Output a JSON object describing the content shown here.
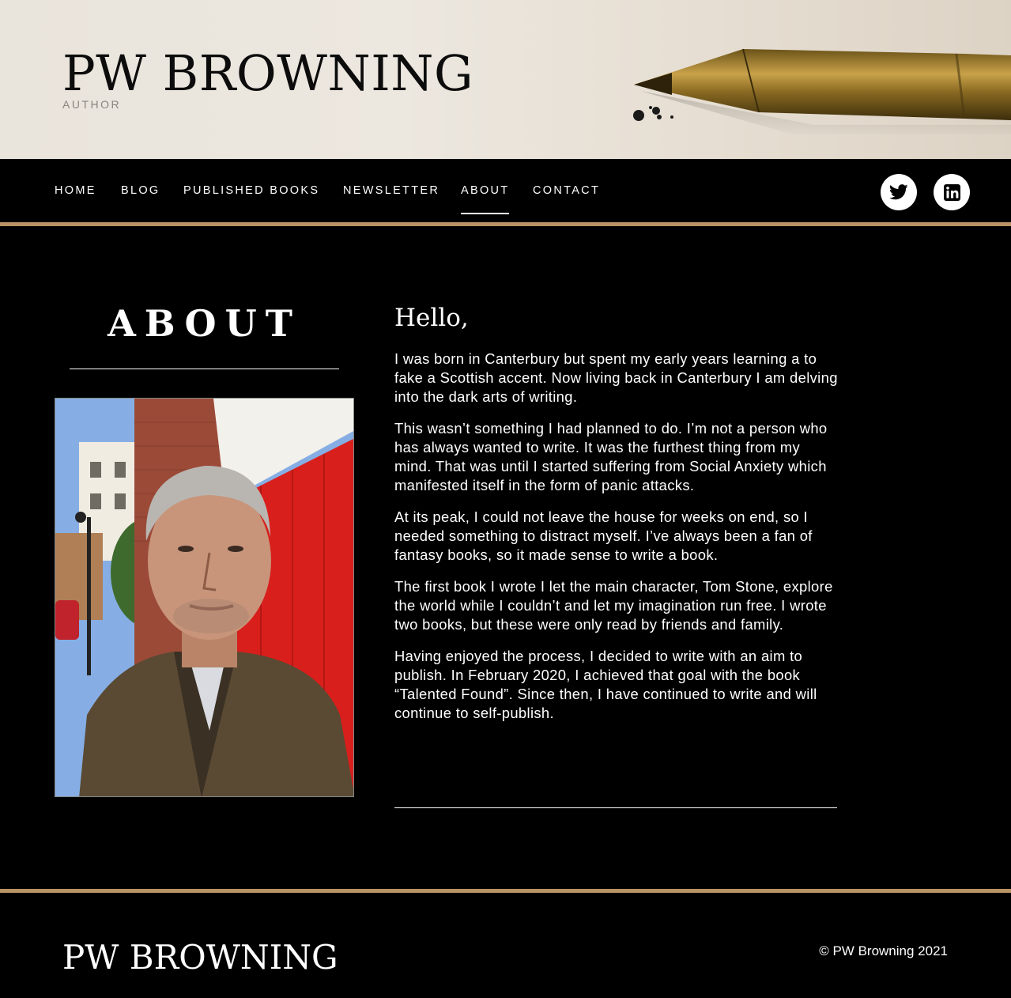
{
  "header": {
    "title": "PW BROWNING",
    "tagline": "AUTHOR"
  },
  "nav": {
    "items": [
      {
        "label": "HOME"
      },
      {
        "label": "BLOG"
      },
      {
        "label": "PUBLISHED BOOKS"
      },
      {
        "label": "NEWSLETTER"
      },
      {
        "label": "ABOUT",
        "active": true
      },
      {
        "label": "CONTACT"
      }
    ],
    "social": [
      {
        "icon": "twitter-icon"
      },
      {
        "icon": "linkedin-icon"
      }
    ]
  },
  "colors": {
    "accent": "#b99266",
    "background": "#000000"
  },
  "main": {
    "heading": "ABOUT",
    "greeting": "Hello,",
    "paragraphs": [
      "I was born in Canterbury but spent my early years learning a to fake a Scottish accent. Now living back in Canterbury I am delving into the dark arts of writing.",
      "This wasn’t something I had planned to do. I’m not a person who has always wanted to write. It was the furthest thing from my mind. That was until I started suffering from Social Anxiety which manifested itself in the form of panic attacks.",
      "At its peak, I could not leave the house for weeks on end, so I needed something to distract myself. I’ve always been a fan of fantasy books, so it made sense to write a book.",
      "The first book I wrote I let the main character, Tom Stone, explore the world while I couldn’t and let my imagination run free. I wrote two books, but these were only read by friends and family.",
      "Having enjoyed the process, I decided to write with an aim to publish. In February 2020, I achieved that goal with the book “Talented Found”. Since then, I have continued to write and will continue to self-publish."
    ]
  },
  "footer": {
    "title": "PW BROWNING",
    "copyright": "© PW Browning 2021"
  }
}
